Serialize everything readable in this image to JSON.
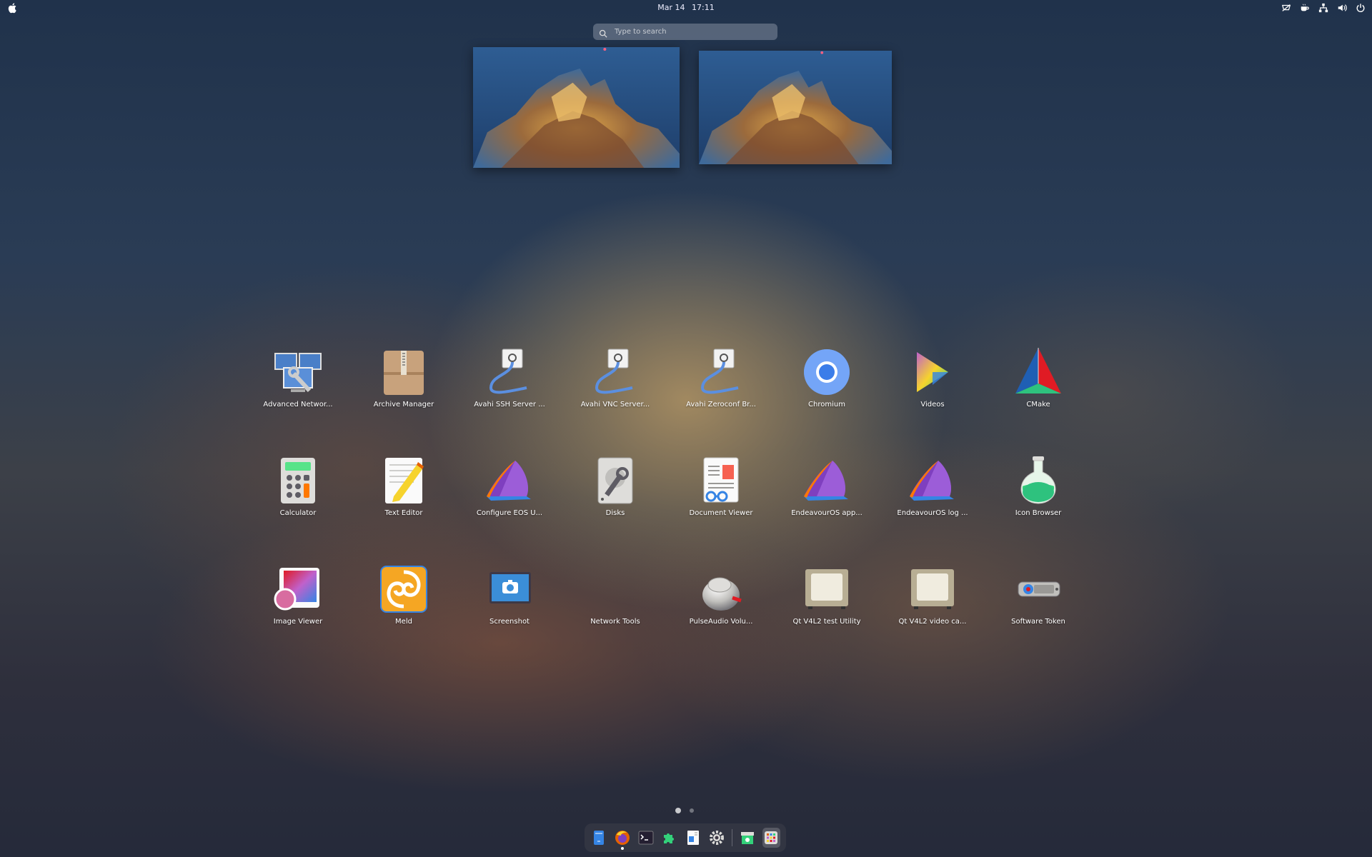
{
  "topbar": {
    "date": "Mar 14",
    "time": "17:11",
    "tray_icons": [
      "notifications-off-icon",
      "coffee-icon",
      "network-icon",
      "volume-icon",
      "power-icon"
    ]
  },
  "search": {
    "placeholder": "Type to search"
  },
  "apps": [
    {
      "label": "Advanced Networ...",
      "icon": "network-config-icon"
    },
    {
      "label": "Archive Manager",
      "icon": "archive-icon"
    },
    {
      "label": "Avahi SSH Server ...",
      "icon": "avahi-icon"
    },
    {
      "label": "Avahi VNC Server...",
      "icon": "avahi-icon"
    },
    {
      "label": "Avahi Zeroconf Br...",
      "icon": "avahi-icon"
    },
    {
      "label": "Chromium",
      "icon": "chromium-icon"
    },
    {
      "label": "Videos",
      "icon": "videos-icon"
    },
    {
      "label": "CMake",
      "icon": "cmake-icon"
    },
    {
      "label": "Calculator",
      "icon": "calculator-icon"
    },
    {
      "label": "Text Editor",
      "icon": "text-editor-icon"
    },
    {
      "label": "Configure EOS U...",
      "icon": "endeavouros-icon"
    },
    {
      "label": "Disks",
      "icon": "disks-icon"
    },
    {
      "label": "Document Viewer",
      "icon": "document-viewer-icon"
    },
    {
      "label": "EndeavourOS app...",
      "icon": "endeavouros-icon"
    },
    {
      "label": "EndeavourOS log ...",
      "icon": "endeavouros-icon"
    },
    {
      "label": "Icon Browser",
      "icon": "flask-icon"
    },
    {
      "label": "Image Viewer",
      "icon": "image-viewer-icon"
    },
    {
      "label": "Meld",
      "icon": "meld-icon"
    },
    {
      "label": "Screenshot",
      "icon": "screenshot-icon"
    },
    {
      "label": "Network Tools",
      "icon": "network-tools-icon"
    },
    {
      "label": "PulseAudio Volu...",
      "icon": "pulseaudio-icon"
    },
    {
      "label": "Qt V4L2 test Utility",
      "icon": "qt-v4l2-icon"
    },
    {
      "label": "Qt V4L2 video ca...",
      "icon": "qt-v4l2-icon"
    },
    {
      "label": "Software Token",
      "icon": "software-token-icon"
    }
  ],
  "pager": {
    "pages": 2,
    "current": 1
  },
  "dock": [
    "files-icon",
    "firefox-icon",
    "terminal-icon",
    "extensions-icon",
    "text-editor-icon",
    "settings-icon",
    "software-icon",
    "app-grid-icon"
  ],
  "colors": {
    "accent": "#3584e4",
    "endeavour_purple": "#7f3fbf"
  }
}
